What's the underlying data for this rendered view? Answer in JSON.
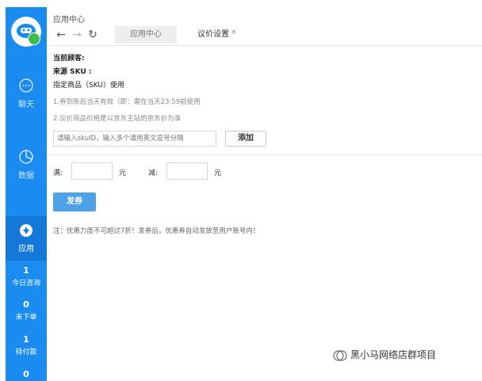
{
  "colors": {
    "sidebar": "#1a8cf0",
    "sidebar_active": "#1478d9",
    "primary_button": "#4ea3e8",
    "online_badge": "#3fbd4c"
  },
  "sidebar": {
    "items": [
      {
        "label": "聊天",
        "icon": "chat-bubble-icon"
      },
      {
        "label": "数据",
        "icon": "pie-chart-icon"
      },
      {
        "label": "应用",
        "icon": "apps-icon",
        "active": true
      }
    ],
    "stats": [
      {
        "value": "1",
        "label": "今日咨询"
      },
      {
        "value": "0",
        "label": "未下单"
      },
      {
        "value": "1",
        "label": "待付款"
      },
      {
        "value": "0",
        "label": ""
      }
    ]
  },
  "header": {
    "breadcrumb": "应用中心",
    "tabs": [
      {
        "label": "应用中心"
      },
      {
        "label": "议价设置",
        "close": "×"
      }
    ]
  },
  "form": {
    "customer_label": "当前顾客:",
    "sku_source_label": "来源 SKU :",
    "designated_label": "指定商品（SKU）使用",
    "notes": [
      "1.券到账后当天有效（即：需在当天23:59前使用",
      "2.议价商品价格是以京东主站的京东价为准"
    ],
    "sku_input_placeholder": "请输入skuID，输入多个请用英文逗号分隔",
    "add_button": "添加",
    "full_label": "满:",
    "minus_label": "减:",
    "unit": "元",
    "issue_button": "发券",
    "footnote": "注：优惠力度不可超过7折！发券后，优惠券自动发放至用户账号内！"
  },
  "watermark": "黑小马网络店群项目"
}
